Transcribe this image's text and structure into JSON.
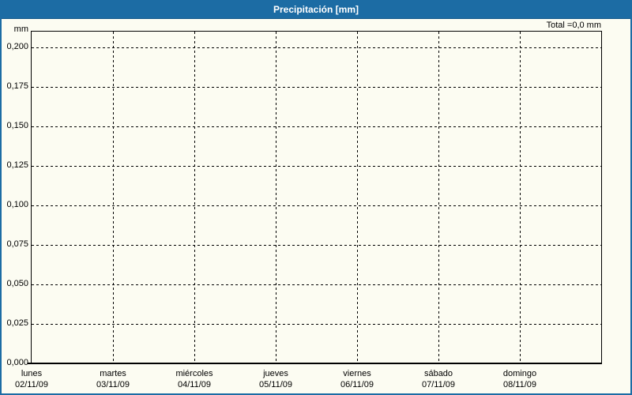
{
  "window": {
    "title": "Precipitación [mm]"
  },
  "chart_data": {
    "type": "bar",
    "title": "Precipitación [mm]",
    "ylabel_unit": "mm",
    "total_label": "Total =0,0 mm",
    "total_mm": 0.0,
    "ylim": [
      0,
      0.21
    ],
    "ytick_interval": 0.025,
    "ytick_labels": [
      "0,200",
      "0,175",
      "0,150",
      "0,125",
      "0,100",
      "0,075",
      "0,050",
      "0,025",
      "0,000"
    ],
    "grid": true,
    "legend": "none",
    "categories": [
      "lunes 02/11/09",
      "martes 03/11/09",
      "miércoles 04/11/09",
      "jueves 05/11/09",
      "viernes 06/11/09",
      "sábado 07/11/09",
      "domingo 08/11/09"
    ],
    "days": [
      {
        "weekday": "lunes",
        "date": "02/11/09",
        "value_mm": 0.0
      },
      {
        "weekday": "martes",
        "date": "03/11/09",
        "value_mm": 0.0
      },
      {
        "weekday": "miércoles",
        "date": "04/11/09",
        "value_mm": 0.0
      },
      {
        "weekday": "jueves",
        "date": "05/11/09",
        "value_mm": 0.0
      },
      {
        "weekday": "viernes",
        "date": "06/11/09",
        "value_mm": 0.0
      },
      {
        "weekday": "sábado",
        "date": "07/11/09",
        "value_mm": 0.0
      },
      {
        "weekday": "domingo",
        "date": "08/11/09",
        "value_mm": 0.0
      }
    ],
    "series": [
      {
        "name": "Precipitación",
        "values": [
          0,
          0,
          0,
          0,
          0,
          0,
          0
        ]
      }
    ],
    "colors": {
      "titlebar_bg": "#1C6CA4",
      "frame_border": "#1C6CA4",
      "page_bg": "#FCFCF2",
      "grid_line": "#000000",
      "axis_text": "#000000",
      "title_text": "#FFFFFF"
    }
  }
}
